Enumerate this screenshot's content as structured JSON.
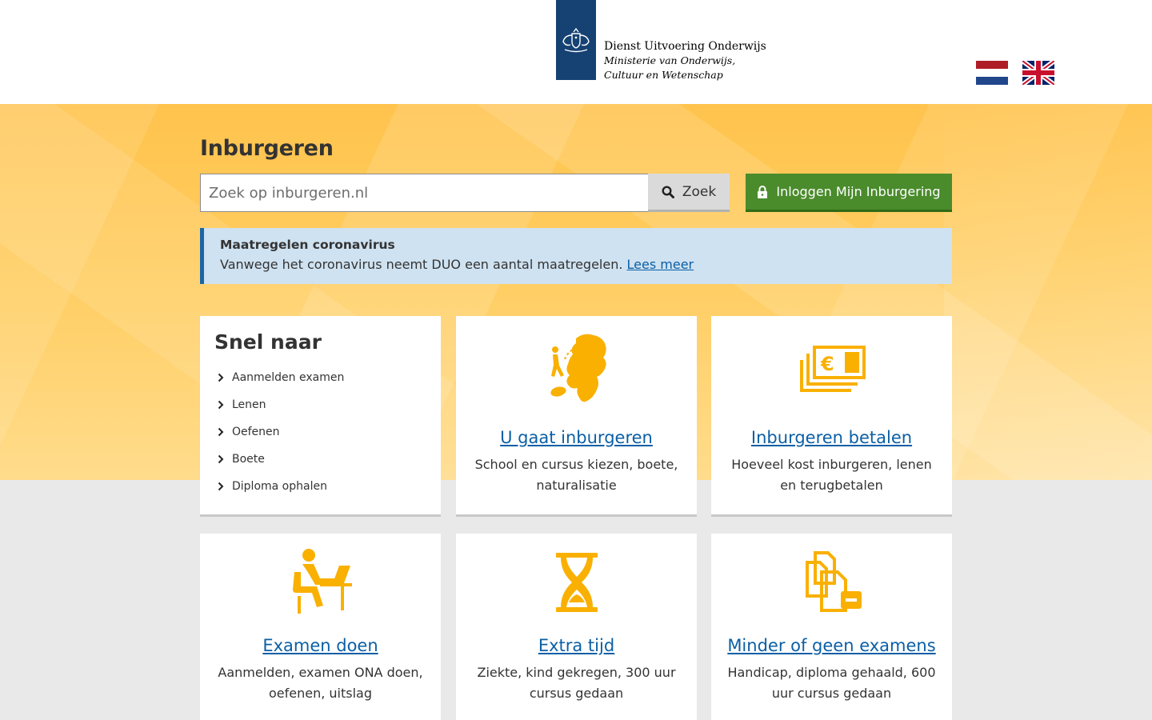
{
  "header": {
    "org_name": "Dienst Uitvoering Onderwijs",
    "ministry": "Ministerie van Onderwijs, Cultuur en Wetenschap",
    "languages": [
      "Nederlands",
      "English"
    ]
  },
  "hero": {
    "title": "Inburgeren",
    "search": {
      "placeholder": "Zoek op inburgeren.nl",
      "value": "",
      "button_label": "Zoek"
    },
    "login_label": "Inloggen Mijn Inburgering"
  },
  "notice": {
    "title": "Maatregelen coronavirus",
    "text": "Vanwege het coronavirus neemt DUO een aantal maatregelen.",
    "link": "Lees meer"
  },
  "quick_links": {
    "title": "Snel naar",
    "items": [
      {
        "label": "Aanmelden examen"
      },
      {
        "label": "Lenen"
      },
      {
        "label": "Oefenen"
      },
      {
        "label": "Boete"
      },
      {
        "label": "Diploma ophalen"
      }
    ]
  },
  "tiles": [
    {
      "title": "U gaat inburgeren",
      "desc": "School en cursus kiezen, boete, naturalisatie",
      "icon": "netherlands-map-icon"
    },
    {
      "title": "Inburgeren betalen",
      "desc": "Hoeveel kost inburgeren, lenen en terugbetalen",
      "icon": "money-icon"
    },
    {
      "title": "Examen doen",
      "desc": "Aanmelden, examen ONA doen, oefenen, uitslag",
      "icon": "laptop-person-icon"
    },
    {
      "title": "Extra tijd",
      "desc": "Ziekte, kind gekregen, 300 uur cursus gedaan",
      "icon": "hourglass-icon"
    },
    {
      "title": "Minder of geen examens",
      "desc": "Handicap, diploma gehaald, 600 uur cursus gedaan",
      "icon": "documents-minus-icon"
    }
  ],
  "colors": {
    "hero_yellow": "#ffc34d",
    "icon_yellow": "#f9b000",
    "link_blue": "#0b5fa5",
    "login_green": "#4a8b2c",
    "notice_bg": "#cfe2f1",
    "logo_blue": "#154273"
  }
}
